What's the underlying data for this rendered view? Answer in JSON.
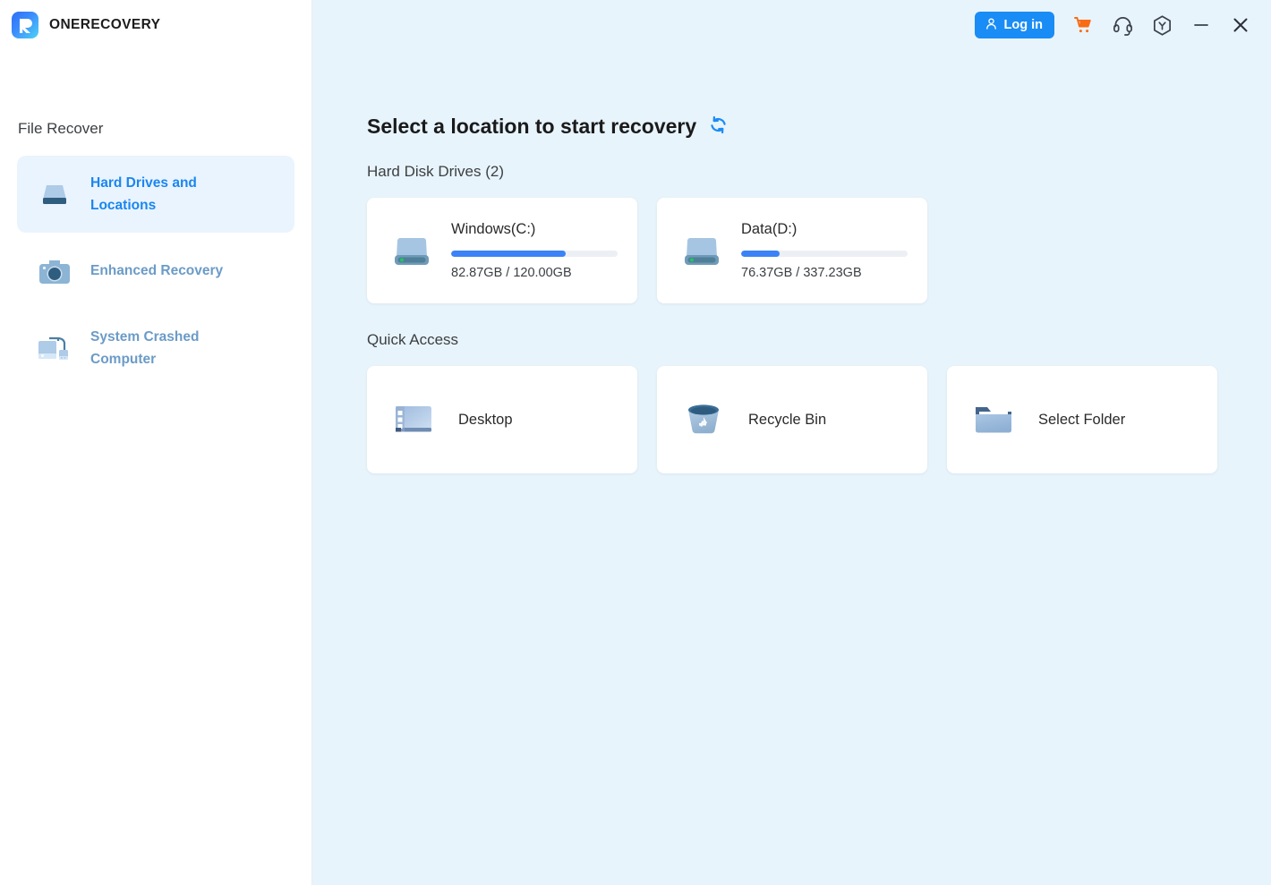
{
  "app": {
    "brand_name": "ONERECOVERY",
    "logo_icon": "onerecovery-logo-icon"
  },
  "titlebar": {
    "login_label": "Log in",
    "user_icon": "user-icon",
    "cart_icon": "shopping-cart-icon",
    "support_icon": "headset-icon",
    "hexagon_icon": "hexagon-y-icon",
    "minimize_icon": "minimize-icon",
    "close_icon": "close-icon"
  },
  "sidebar": {
    "section_title": "File Recover",
    "items": [
      {
        "label": "Hard Drives and Locations",
        "icon": "hard-drive-icon",
        "active": true
      },
      {
        "label": "Enhanced Recovery",
        "icon": "camera-icon",
        "active": false
      },
      {
        "label": "System Crashed Computer",
        "icon": "crashed-computer-icon",
        "active": false
      }
    ]
  },
  "main": {
    "page_title": "Select a location to start recovery",
    "refresh_icon": "refresh-icon",
    "hard_disk_section_label": "Hard Disk Drives (2)",
    "quick_access_label": "Quick Access",
    "drives": [
      {
        "name": "Windows(C:)",
        "size_text": "82.87GB / 120.00GB",
        "used_percent": 69,
        "icon": "hard-drive-icon"
      },
      {
        "name": "Data(D:)",
        "size_text": "76.37GB / 337.23GB",
        "used_percent": 23,
        "icon": "hard-drive-icon"
      }
    ],
    "quick_access": [
      {
        "label": "Desktop",
        "icon": "desktop-icon"
      },
      {
        "label": "Recycle Bin",
        "icon": "recycle-bin-icon"
      },
      {
        "label": "Select Folder",
        "icon": "folder-icon"
      }
    ]
  },
  "colors": {
    "accent_blue": "#1a8cf5",
    "progress_blue": "#3b82f6",
    "cart_orange": "#f96b15",
    "main_background": "#e8f4fb",
    "active_item_background": "#eaf4fe",
    "inactive_label": "#6b9bc7"
  }
}
